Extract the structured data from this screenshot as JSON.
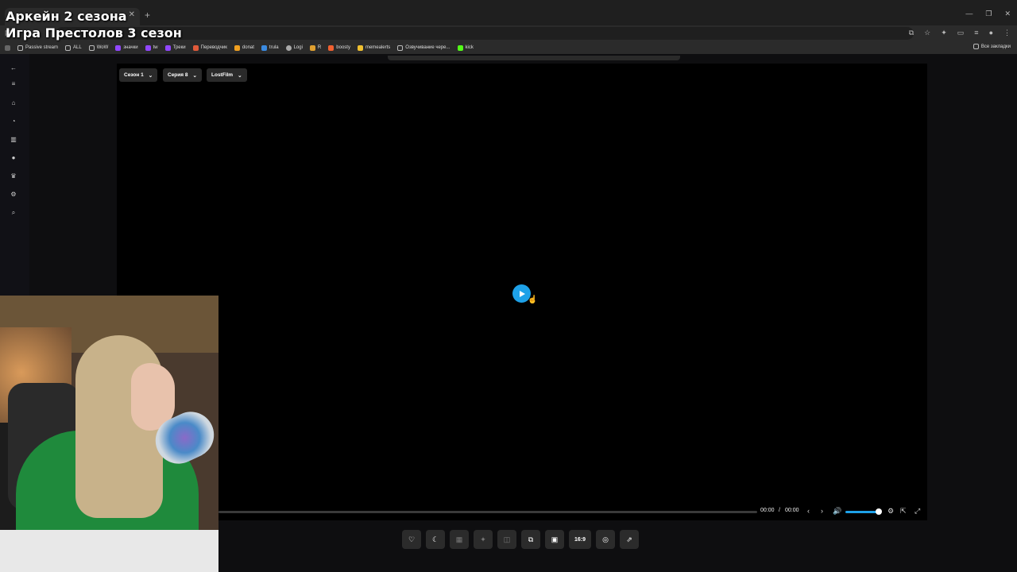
{
  "overlay": {
    "line1": "Аркейн 2 сезона",
    "line2": "Игра Престолов 3 сезон"
  },
  "browser": {
    "new_tab_icon": "plus-icon",
    "bookmarks": [
      {
        "label": "Passive stream",
        "icon": "folder-icon"
      },
      {
        "label": "ALL",
        "icon": "folder-icon"
      },
      {
        "label": "WoW",
        "icon": "folder-icon"
      },
      {
        "label": "значки",
        "icon": "app-icon"
      },
      {
        "label": "tw",
        "icon": "app-icon"
      },
      {
        "label": "Треки",
        "icon": "app-icon"
      },
      {
        "label": "Переводчик",
        "icon": "app-icon"
      },
      {
        "label": "donat",
        "icon": "app-icon"
      },
      {
        "label": "trula",
        "icon": "app-icon"
      },
      {
        "label": "Logi",
        "icon": "app-icon"
      },
      {
        "label": "R",
        "icon": "app-icon"
      },
      {
        "label": "boosty",
        "icon": "app-icon"
      },
      {
        "label": "memealerts",
        "icon": "app-icon"
      },
      {
        "label": "Озвучивание чере...",
        "icon": "page-icon"
      },
      {
        "label": "kick",
        "icon": "app-icon"
      }
    ],
    "all_bookmarks": "Все закладки"
  },
  "player": {
    "season_label": "Сезон 1",
    "episode_label": "Серия 8",
    "voice_label": "LostFilm",
    "time_current": "00:00",
    "time_separator": "/",
    "time_total": "00:00",
    "volume_level": 0.85,
    "aspect_label": "16:9"
  },
  "colors": {
    "accent": "#1ea1e8",
    "background": "#0e0e10"
  }
}
